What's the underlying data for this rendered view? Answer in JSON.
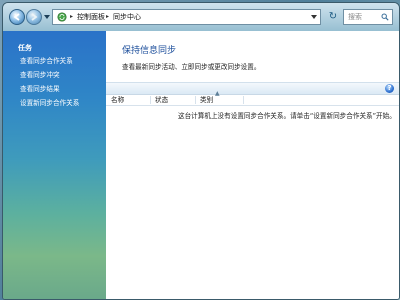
{
  "address_bar": {
    "crumbs": [
      "控制面板",
      "同步中心"
    ]
  },
  "search": {
    "placeholder": "搜索"
  },
  "sidebar": {
    "title": "任务",
    "items": [
      {
        "label": "查看同步合作关系"
      },
      {
        "label": "查看同步冲突"
      },
      {
        "label": "查看同步结果"
      },
      {
        "label": "设置新同步合作关系"
      }
    ]
  },
  "main": {
    "title": "保持信息同步",
    "description": "查看最新同步活动、立即同步或更改同步设置。",
    "columns": [
      "名称",
      "状态",
      "类别"
    ],
    "empty_message": "这台计算机上没有设置同步合作关系。请单击“设置新同步合作关系”开始。",
    "help_glyph": "?"
  },
  "colors": {
    "title_blue": "#1c4e9b",
    "sidebar_top": "#2a72c8",
    "sidebar_bottom": "#6aa98a"
  }
}
